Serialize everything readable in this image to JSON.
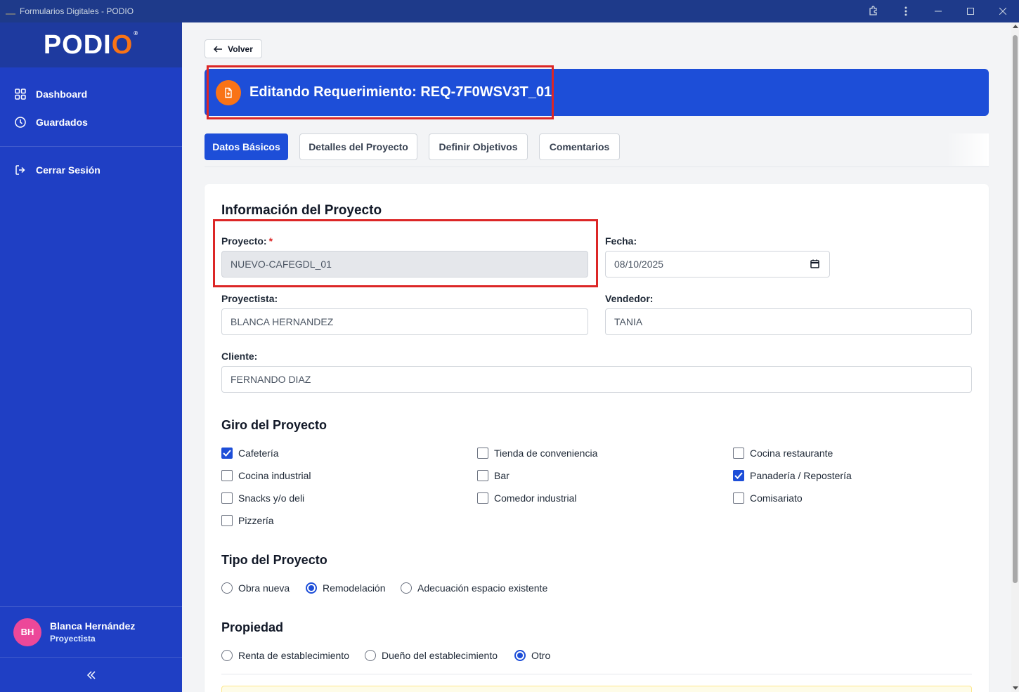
{
  "window": {
    "title": "Formularios Digitales - PODIO"
  },
  "sidebar": {
    "logo": "PODIO",
    "items": [
      {
        "label": "Dashboard",
        "icon": "grid-icon"
      },
      {
        "label": "Guardados",
        "icon": "clock-icon"
      }
    ],
    "logout": {
      "label": "Cerrar Sesión",
      "icon": "logout-icon"
    },
    "user": {
      "initials": "BH",
      "name": "Blanca Hernández",
      "role": "Proyectista"
    }
  },
  "main": {
    "back_label": "Volver",
    "header_title": "Editando Requerimiento: REQ-7F0WSV3T_01",
    "tabs": [
      {
        "label": "Datos Básicos",
        "active": true
      },
      {
        "label": "Detalles del Proyecto",
        "active": false
      },
      {
        "label": "Definir Objetivos",
        "active": false
      },
      {
        "label": "Comentarios",
        "active": false
      }
    ],
    "info": {
      "title": "Información del Proyecto",
      "proyecto_label": "Proyecto:",
      "required_mark": "*",
      "proyecto_value": "NUEVO-CAFEGDL_01",
      "fecha_label": "Fecha:",
      "fecha_value": "08/10/2025",
      "proyectista_label": "Proyectista:",
      "proyectista_value": "BLANCA HERNANDEZ",
      "vendedor_label": "Vendedor:",
      "vendedor_value": "TANIA",
      "cliente_label": "Cliente:",
      "cliente_value": "FERNANDO DIAZ"
    },
    "giro": {
      "title": "Giro del Proyecto",
      "options": [
        {
          "label": "Cafetería",
          "checked": true
        },
        {
          "label": "Tienda de conveniencia",
          "checked": false
        },
        {
          "label": "Cocina restaurante",
          "checked": false
        },
        {
          "label": "Cocina industrial",
          "checked": false
        },
        {
          "label": "Bar",
          "checked": false
        },
        {
          "label": "Panadería / Repostería",
          "checked": true
        },
        {
          "label": "Snacks y/o deli",
          "checked": false
        },
        {
          "label": "Comedor industrial",
          "checked": false
        },
        {
          "label": "Comisariato",
          "checked": false
        },
        {
          "label": "Pizzería",
          "checked": false
        }
      ]
    },
    "tipo": {
      "title": "Tipo del Proyecto",
      "options": [
        {
          "label": "Obra nueva",
          "checked": false
        },
        {
          "label": "Remodelación",
          "checked": true
        },
        {
          "label": "Adecuación espacio existente",
          "checked": false
        }
      ]
    },
    "propiedad": {
      "title": "Propiedad",
      "options": [
        {
          "label": "Renta de establecimiento",
          "checked": false
        },
        {
          "label": "Dueño del establecimiento",
          "checked": false
        },
        {
          "label": "Otro",
          "checked": true
        }
      ]
    }
  },
  "colors": {
    "primary": "#1d4ed8",
    "sidebar": "#1f3fc4",
    "accent": "#f97316",
    "highlight": "#dc2626"
  }
}
